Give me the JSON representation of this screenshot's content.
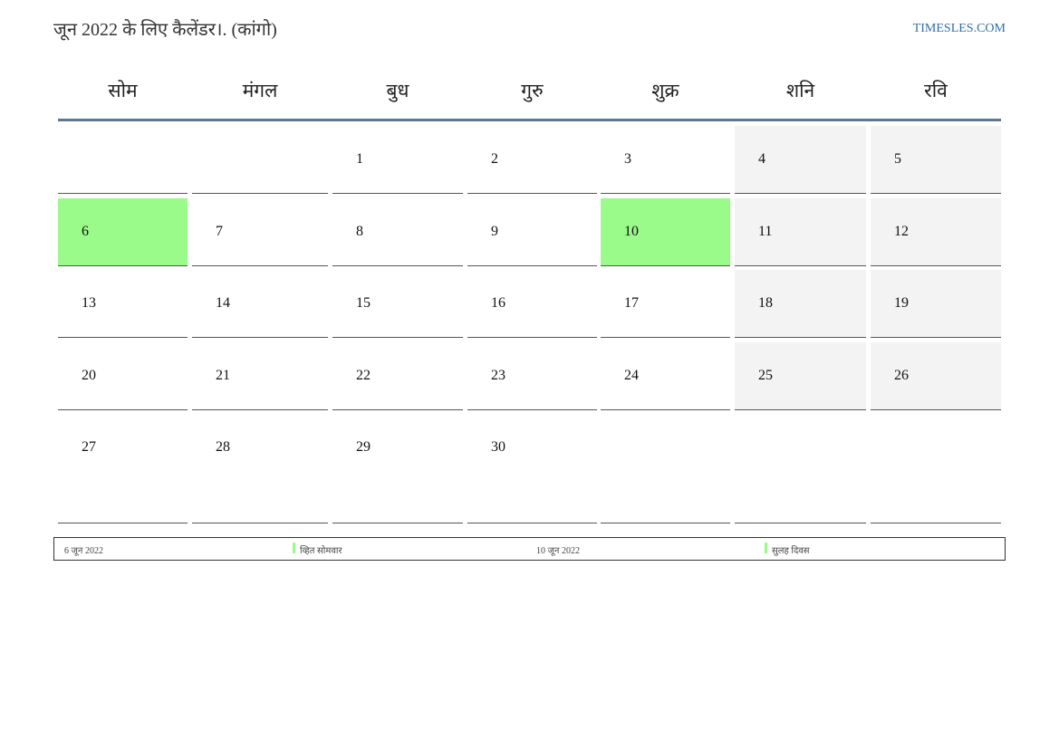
{
  "header": {
    "title": "जून 2022 के लिए कैलेंडर।. (कांगो)",
    "site": "TIMESLES.COM"
  },
  "calendar": {
    "weekdays": [
      "सोम",
      "मंगल",
      "बुध",
      "गुरु",
      "शुक्र",
      "शनि",
      "रवि"
    ],
    "weeks": [
      [
        "",
        "",
        "1",
        "2",
        "3",
        "4",
        "5"
      ],
      [
        "6",
        "7",
        "8",
        "9",
        "10",
        "11",
        "12"
      ],
      [
        "13",
        "14",
        "15",
        "16",
        "17",
        "18",
        "19"
      ],
      [
        "20",
        "21",
        "22",
        "23",
        "24",
        "25",
        "26"
      ],
      [
        "27",
        "28",
        "29",
        "30",
        "",
        "",
        ""
      ]
    ],
    "holidays": [
      "6",
      "10"
    ],
    "colors": {
      "holiday": "#9afa8a",
      "weekend": "#f3f3f3",
      "header_rule": "#5a7797"
    }
  },
  "legend": [
    {
      "date": "6 जून 2022",
      "name": "व्हित सोमवार"
    },
    {
      "date": "10 जून 2022",
      "name": "सुलह दिवस"
    }
  ]
}
